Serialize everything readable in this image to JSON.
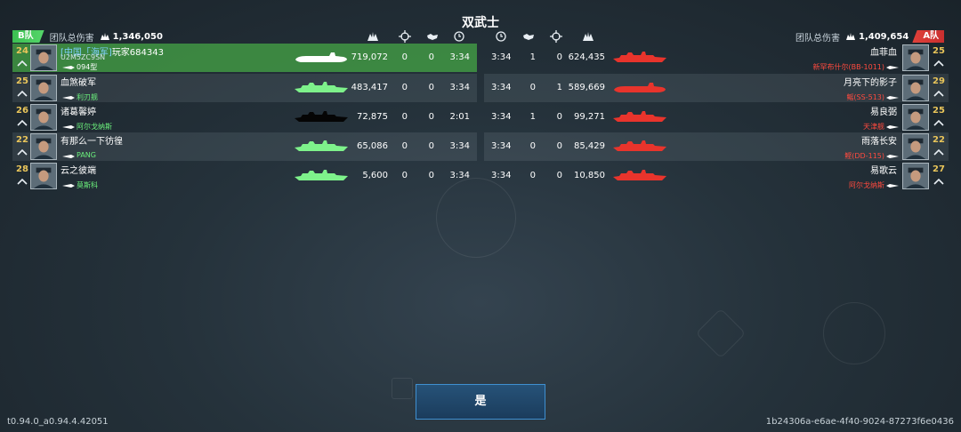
{
  "title": "双武士",
  "team_b": {
    "tag": "B队",
    "label": "团队总伤害",
    "damage": "1,346,050"
  },
  "team_a": {
    "tag": "A队",
    "label": "团队总伤害",
    "damage": "1,409,654"
  },
  "left_players": [
    {
      "level": "24",
      "clan": "[中国「海军]",
      "name": "玩家684343",
      "id": "U2M5ZC9SN",
      "ship": "094型",
      "ship_color": "w",
      "damage": "719,072",
      "c1": "0",
      "c2": "0",
      "time": "3:34",
      "self": true
    },
    {
      "level": "25",
      "clan": "",
      "name": "血煞破军",
      "id": "",
      "ship": "利刃舰",
      "ship_color": "g",
      "damage": "483,417",
      "c1": "0",
      "c2": "0",
      "time": "3:34",
      "self": false
    },
    {
      "level": "26",
      "clan": "",
      "name": "诸葛馨婷",
      "id": "",
      "ship": "阿尔戈纳斯",
      "ship_color": "g",
      "damage": "72,875",
      "c1": "0",
      "c2": "0",
      "time": "2:01",
      "self": false
    },
    {
      "level": "22",
      "clan": "",
      "name": "有那么一下彷徨",
      "id": "",
      "ship": "PANG",
      "ship_color": "g",
      "damage": "65,086",
      "c1": "0",
      "c2": "0",
      "time": "3:34",
      "self": false
    },
    {
      "level": "28",
      "clan": "",
      "name": "云之彼端",
      "id": "",
      "ship": "莫斯科",
      "ship_color": "g",
      "damage": "5,600",
      "c1": "0",
      "c2": "0",
      "time": "3:34",
      "self": false
    }
  ],
  "right_players": [
    {
      "level": "25",
      "name": "血菲血",
      "ship": "新罕布什尔(BB-1011)",
      "damage": "624,435",
      "c1": "1",
      "c2": "0",
      "time": "3:34"
    },
    {
      "level": "29",
      "name": "月亮下的影子",
      "ship": "鳐(SS-513)",
      "damage": "589,669",
      "c1": "0",
      "c2": "1",
      "time": "3:34"
    },
    {
      "level": "25",
      "name": "易良弼",
      "ship": "天津舰",
      "damage": "99,271",
      "c1": "1",
      "c2": "0",
      "time": "3:34"
    },
    {
      "level": "22",
      "name": "雨落长安",
      "ship": "鲣(DD-115)",
      "damage": "85,429",
      "c1": "0",
      "c2": "0",
      "time": "3:34"
    },
    {
      "level": "27",
      "name": "易歌云",
      "ship": "阿尔戈纳斯",
      "damage": "10,850",
      "c1": "0",
      "c2": "0",
      "time": "3:34"
    }
  ],
  "confirm_label": "是",
  "version": "t0.94.0_a0.94.4.42051",
  "session_id": "1b24306a-e6ae-4f40-9024-87273f6e0436",
  "colors": {
    "team_b": "#4fcf62",
    "team_a": "#e0413a",
    "self_row": "#46aa46",
    "ally_silhouette": "#7ef28b",
    "enemy_silhouette": "#e8342c"
  },
  "icons": [
    "damage-icon",
    "crosshair-icon",
    "handshake-icon",
    "clock-icon",
    "rank-chevron-icon",
    "ship-silhouette-icon"
  ]
}
